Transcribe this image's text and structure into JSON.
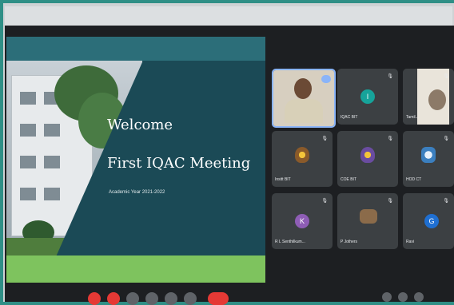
{
  "slide": {
    "title": "Welcome",
    "subtitle": "First IQAC Meeting",
    "year": "Academic Year 2021-2022"
  },
  "participants": [
    {
      "name": "",
      "initial": "",
      "kind": "video-person",
      "color": "#5a7da0"
    },
    {
      "name": "IQAC BIT",
      "initial": "I",
      "kind": "avatar",
      "color": "#16a39a"
    },
    {
      "name": "Tamil...",
      "initial": "",
      "kind": "video-person-2",
      "color": "#c7c2b6"
    },
    {
      "name": "Insitt BIT",
      "initial": "",
      "kind": "logo",
      "color": "#8a5a2a"
    },
    {
      "name": "COE BIT",
      "initial": "",
      "kind": "logo",
      "color": "#6a4ca0"
    },
    {
      "name": "HOD CT",
      "initial": "",
      "kind": "logo",
      "color": "#3b7fbf"
    },
    {
      "name": "R L Senthilkum...",
      "initial": "K",
      "kind": "avatar",
      "color": "#8e5db5"
    },
    {
      "name": "P Jothers",
      "initial": "",
      "kind": "photo",
      "color": "#8b6b4a"
    },
    {
      "name": "Ravi",
      "initial": "G",
      "kind": "avatar",
      "color": "#1f6fd1"
    }
  ],
  "controls": {
    "colors": [
      "#e53935",
      "#e53935",
      "#5f6368",
      "#5f6368",
      "#5f6368",
      "#5f6368",
      "#e53935"
    ]
  }
}
